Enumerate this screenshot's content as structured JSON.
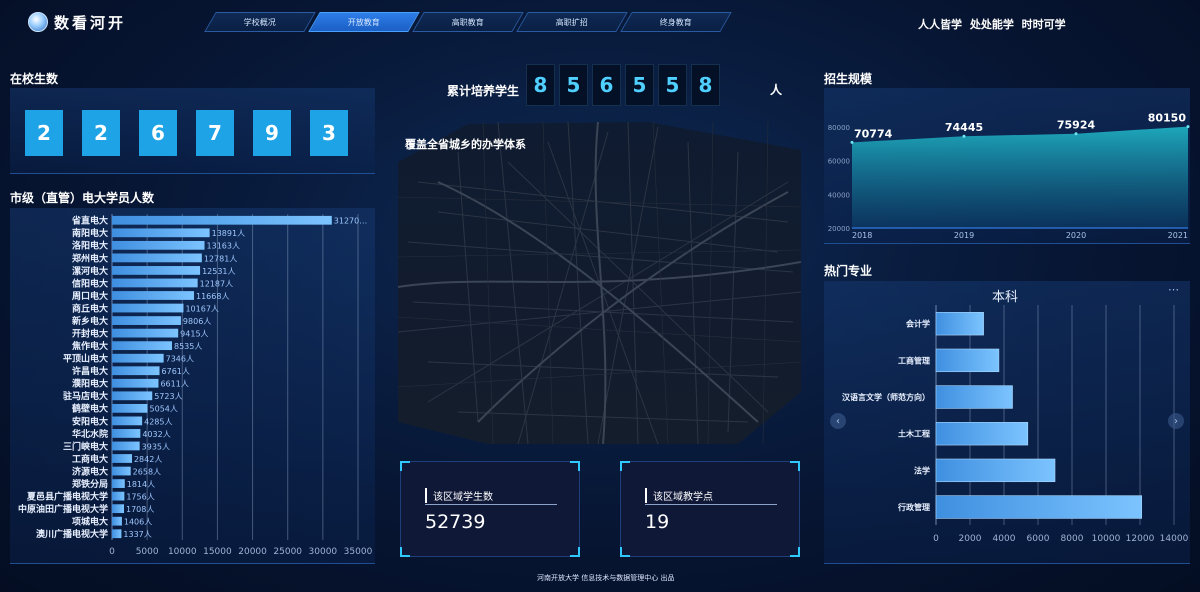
{
  "header": {
    "logo_text": "数看河开",
    "tabs": [
      "学校概况",
      "开放教育",
      "高职教育",
      "高职扩招",
      "终身教育"
    ],
    "active_tab": 1,
    "slogan": "人人皆学  处处能学  时时可学"
  },
  "enrolled": {
    "title": "在校生数",
    "digits": [
      "2",
      "2",
      "6",
      "7",
      "9",
      "3"
    ]
  },
  "center": {
    "total_label": "累计培养学生",
    "total_digits": [
      "8",
      "5",
      "6",
      "5",
      "5",
      "8"
    ],
    "total_unit": "人",
    "map_title": "覆盖全省城乡的办学体系",
    "card1": {
      "label": "该区域学生数",
      "value": "52739"
    },
    "card2": {
      "label": "该区域教学点",
      "value": "19"
    },
    "footer": "河南开放大学 信息技术与数据管理中心 出品"
  },
  "colors": {
    "accent": "#1ea3e6",
    "bar_light": "#7cc4ff",
    "bar_dark": "#3f8fe0",
    "digit_text": "#4fd0ff"
  },
  "chart_data": [
    {
      "type": "bar",
      "title": "市级（直管）电大学员人数",
      "orientation": "horizontal",
      "categories": [
        "省直电大",
        "南阳电大",
        "洛阳电大",
        "郑州电大",
        "漯河电大",
        "信阳电大",
        "周口电大",
        "商丘电大",
        "新乡电大",
        "开封电大",
        "焦作电大",
        "平顶山电大",
        "许昌电大",
        "濮阳电大",
        "驻马店电大",
        "鹤壁电大",
        "安阳电大",
        "华北水院",
        "三门峡电大",
        "工商电大",
        "济源电大",
        "郑铁分局",
        "夏邑县广播电视大学",
        "中原油田广播电视大学",
        "项城电大",
        "澳川广播电视大学"
      ],
      "values": [
        31270,
        13891,
        13163,
        12781,
        12531,
        12187,
        11668,
        10167,
        9806,
        9415,
        8535,
        7346,
        6761,
        6611,
        5723,
        5054,
        4285,
        4032,
        3935,
        2842,
        2658,
        1814,
        1756,
        1708,
        1406,
        1337
      ],
      "data_labels": [
        "31270…",
        "13891人",
        "13163人",
        "12781人",
        "12531人",
        "12187人",
        "11668人",
        "10167人",
        "9806人",
        "9415人",
        "8535人",
        "7346人",
        "6761人",
        "6611人",
        "5723人",
        "5054人",
        "4285人",
        "4032人",
        "3935人",
        "2842人",
        "2658人",
        "1814人",
        "1756人",
        "1708人",
        "1406人",
        "1337人"
      ],
      "xlim": [
        0,
        35000
      ],
      "xticks": [
        "0",
        "5000",
        "10000",
        "15000",
        "20000",
        "25000",
        "30000",
        "35000"
      ],
      "grid": true
    },
    {
      "type": "area",
      "title": "招生规模",
      "x": [
        "2018",
        "2019",
        "2020",
        "2021"
      ],
      "values": [
        70774,
        74445,
        75924,
        80150
      ],
      "data_labels": [
        "70774",
        "74445",
        "75924",
        "80150"
      ],
      "ylim": [
        20000,
        90000
      ],
      "yticks": [
        "80000",
        "60000",
        "40000",
        "20000"
      ],
      "grid": false
    },
    {
      "type": "bar",
      "title": "热门专业",
      "subtitle": "本科",
      "orientation": "horizontal",
      "categories": [
        "会计学",
        "工商管理",
        "汉语言文学（师范方向）",
        "土木工程",
        "法学",
        "行政管理"
      ],
      "values": [
        2800,
        3700,
        4500,
        5400,
        7000,
        12100
      ],
      "xlim": [
        0,
        14000
      ],
      "xticks": [
        "0",
        "2000",
        "4000",
        "6000",
        "8000",
        "10000",
        "12000",
        "14000"
      ],
      "grid": true
    }
  ]
}
